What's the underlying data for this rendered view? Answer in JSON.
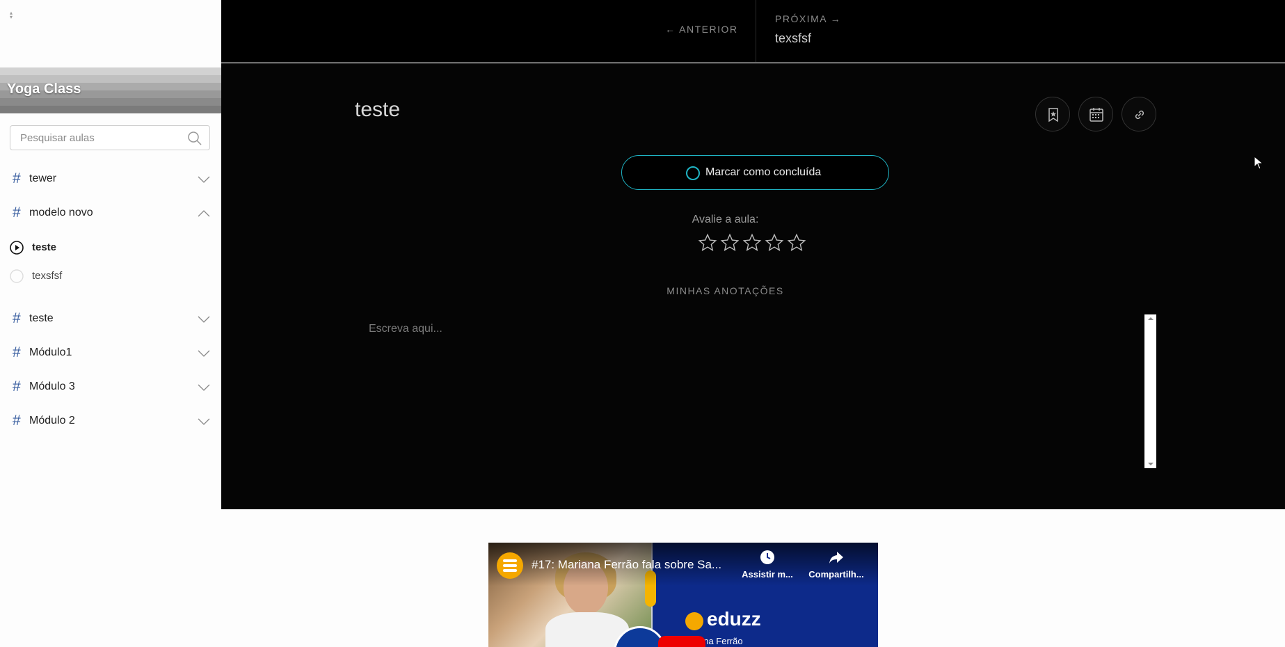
{
  "sidebar": {
    "course_title": "Yoga Class",
    "banner_stripes": [
      "#cfcfcf",
      "#bdbdbd",
      "#a9a9a9",
      "#979797",
      "#878787",
      "#7a7a7a"
    ],
    "search_placeholder": "Pesquisar aulas",
    "modules": [
      {
        "label": "tewer",
        "expanded": false
      },
      {
        "label": "modelo novo",
        "expanded": true
      },
      {
        "label": "teste",
        "expanded": false
      },
      {
        "label": "Módulo1",
        "expanded": false
      },
      {
        "label": "Módulo 3",
        "expanded": false
      },
      {
        "label": "Módulo 2",
        "expanded": false
      }
    ],
    "lessons": [
      {
        "label": "teste",
        "current": true
      },
      {
        "label": "texsfsf",
        "current": false
      }
    ]
  },
  "nav": {
    "prev_label": "← ANTERIOR",
    "next_label": "PRÓXIMA →",
    "next_title": "texsfsf"
  },
  "lesson": {
    "title": "teste",
    "complete_label": "Marcar como concluída",
    "rate_label": "Avalie a aula:",
    "rating": 0,
    "rating_max": 5,
    "notes_label": "MINHAS ANOTAÇÕES",
    "notes_placeholder": "Escreva aqui..."
  },
  "actions": {
    "icons": [
      "bookmark-icon",
      "calendar-icon",
      "link-icon"
    ]
  },
  "video": {
    "title": "#17: Mariana Ferrão fala sobre Sa...",
    "watch_later": "Assistir m...",
    "share": "Compartilh...",
    "brand": "eduzz",
    "subtitle": "ana Ferrão"
  },
  "colors": {
    "accent": "#1fb4c4",
    "hash": "#3a5fa0",
    "main_bg": "#050505"
  }
}
